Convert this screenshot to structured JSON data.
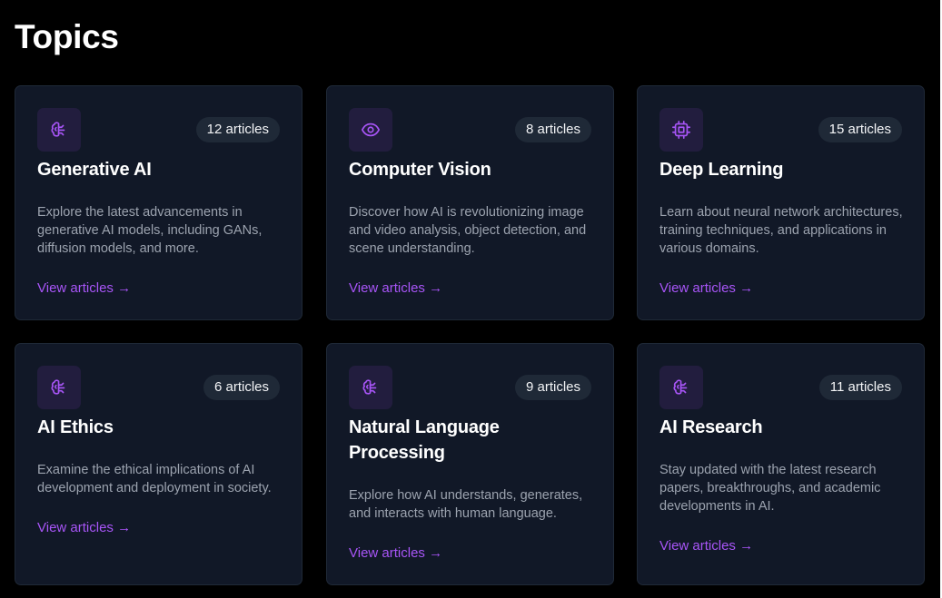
{
  "page": {
    "title": "Topics"
  },
  "colors": {
    "background": "#000000",
    "card_background": "#111827",
    "card_border": "#1f2937",
    "accent": "#a855f7",
    "icon_background": "#221d3e",
    "badge_background": "#1f2937",
    "description_text": "#9ca3af"
  },
  "topics": [
    {
      "icon": "brain-icon",
      "count": "12 articles",
      "title": "Generative AI",
      "description": "Explore the latest advancements in generative AI models, including GANs, diffusion models, and more.",
      "link": "View articles →"
    },
    {
      "icon": "eye-icon",
      "count": "8 articles",
      "title": "Computer Vision",
      "description": "Discover how AI is revolutionizing image and video analysis, object detection, and scene understanding.",
      "link": "View articles →"
    },
    {
      "icon": "cpu-icon",
      "count": "15 articles",
      "title": "Deep Learning",
      "description": "Learn about neural network architectures, training techniques, and applications in various domains.",
      "link": "View articles →"
    },
    {
      "icon": "brain-icon",
      "count": "6 articles",
      "title": "AI Ethics",
      "description": "Examine the ethical implications of AI development and deployment in society.",
      "link": "View articles →"
    },
    {
      "icon": "brain-icon",
      "count": "9 articles",
      "title": "Natural Language Processing",
      "description": "Explore how AI understands, generates, and interacts with human language.",
      "link": "View articles →"
    },
    {
      "icon": "brain-icon",
      "count": "11 articles",
      "title": "AI Research",
      "description": "Stay updated with the latest research papers, breakthroughs, and academic developments in AI.",
      "link": "View articles →"
    }
  ]
}
